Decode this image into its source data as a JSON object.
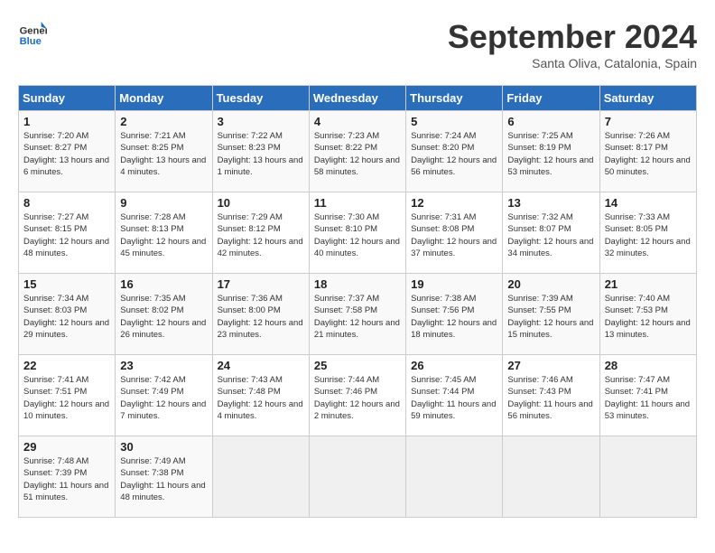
{
  "header": {
    "logo_general": "General",
    "logo_blue": "Blue",
    "month": "September 2024",
    "location": "Santa Oliva, Catalonia, Spain"
  },
  "weekdays": [
    "Sunday",
    "Monday",
    "Tuesday",
    "Wednesday",
    "Thursday",
    "Friday",
    "Saturday"
  ],
  "days": [
    {
      "date": "",
      "sunrise": "",
      "sunset": "",
      "daylight": ""
    },
    {
      "date": "1",
      "sunrise": "Sunrise: 7:20 AM",
      "sunset": "Sunset: 8:27 PM",
      "daylight": "Daylight: 13 hours and 6 minutes."
    },
    {
      "date": "2",
      "sunrise": "Sunrise: 7:21 AM",
      "sunset": "Sunset: 8:25 PM",
      "daylight": "Daylight: 13 hours and 4 minutes."
    },
    {
      "date": "3",
      "sunrise": "Sunrise: 7:22 AM",
      "sunset": "Sunset: 8:23 PM",
      "daylight": "Daylight: 13 hours and 1 minute."
    },
    {
      "date": "4",
      "sunrise": "Sunrise: 7:23 AM",
      "sunset": "Sunset: 8:22 PM",
      "daylight": "Daylight: 12 hours and 58 minutes."
    },
    {
      "date": "5",
      "sunrise": "Sunrise: 7:24 AM",
      "sunset": "Sunset: 8:20 PM",
      "daylight": "Daylight: 12 hours and 56 minutes."
    },
    {
      "date": "6",
      "sunrise": "Sunrise: 7:25 AM",
      "sunset": "Sunset: 8:19 PM",
      "daylight": "Daylight: 12 hours and 53 minutes."
    },
    {
      "date": "7",
      "sunrise": "Sunrise: 7:26 AM",
      "sunset": "Sunset: 8:17 PM",
      "daylight": "Daylight: 12 hours and 50 minutes."
    },
    {
      "date": "8",
      "sunrise": "Sunrise: 7:27 AM",
      "sunset": "Sunset: 8:15 PM",
      "daylight": "Daylight: 12 hours and 48 minutes."
    },
    {
      "date": "9",
      "sunrise": "Sunrise: 7:28 AM",
      "sunset": "Sunset: 8:13 PM",
      "daylight": "Daylight: 12 hours and 45 minutes."
    },
    {
      "date": "10",
      "sunrise": "Sunrise: 7:29 AM",
      "sunset": "Sunset: 8:12 PM",
      "daylight": "Daylight: 12 hours and 42 minutes."
    },
    {
      "date": "11",
      "sunrise": "Sunrise: 7:30 AM",
      "sunset": "Sunset: 8:10 PM",
      "daylight": "Daylight: 12 hours and 40 minutes."
    },
    {
      "date": "12",
      "sunrise": "Sunrise: 7:31 AM",
      "sunset": "Sunset: 8:08 PM",
      "daylight": "Daylight: 12 hours and 37 minutes."
    },
    {
      "date": "13",
      "sunrise": "Sunrise: 7:32 AM",
      "sunset": "Sunset: 8:07 PM",
      "daylight": "Daylight: 12 hours and 34 minutes."
    },
    {
      "date": "14",
      "sunrise": "Sunrise: 7:33 AM",
      "sunset": "Sunset: 8:05 PM",
      "daylight": "Daylight: 12 hours and 32 minutes."
    },
    {
      "date": "15",
      "sunrise": "Sunrise: 7:34 AM",
      "sunset": "Sunset: 8:03 PM",
      "daylight": "Daylight: 12 hours and 29 minutes."
    },
    {
      "date": "16",
      "sunrise": "Sunrise: 7:35 AM",
      "sunset": "Sunset: 8:02 PM",
      "daylight": "Daylight: 12 hours and 26 minutes."
    },
    {
      "date": "17",
      "sunrise": "Sunrise: 7:36 AM",
      "sunset": "Sunset: 8:00 PM",
      "daylight": "Daylight: 12 hours and 23 minutes."
    },
    {
      "date": "18",
      "sunrise": "Sunrise: 7:37 AM",
      "sunset": "Sunset: 7:58 PM",
      "daylight": "Daylight: 12 hours and 21 minutes."
    },
    {
      "date": "19",
      "sunrise": "Sunrise: 7:38 AM",
      "sunset": "Sunset: 7:56 PM",
      "daylight": "Daylight: 12 hours and 18 minutes."
    },
    {
      "date": "20",
      "sunrise": "Sunrise: 7:39 AM",
      "sunset": "Sunset: 7:55 PM",
      "daylight": "Daylight: 12 hours and 15 minutes."
    },
    {
      "date": "21",
      "sunrise": "Sunrise: 7:40 AM",
      "sunset": "Sunset: 7:53 PM",
      "daylight": "Daylight: 12 hours and 13 minutes."
    },
    {
      "date": "22",
      "sunrise": "Sunrise: 7:41 AM",
      "sunset": "Sunset: 7:51 PM",
      "daylight": "Daylight: 12 hours and 10 minutes."
    },
    {
      "date": "23",
      "sunrise": "Sunrise: 7:42 AM",
      "sunset": "Sunset: 7:49 PM",
      "daylight": "Daylight: 12 hours and 7 minutes."
    },
    {
      "date": "24",
      "sunrise": "Sunrise: 7:43 AM",
      "sunset": "Sunset: 7:48 PM",
      "daylight": "Daylight: 12 hours and 4 minutes."
    },
    {
      "date": "25",
      "sunrise": "Sunrise: 7:44 AM",
      "sunset": "Sunset: 7:46 PM",
      "daylight": "Daylight: 12 hours and 2 minutes."
    },
    {
      "date": "26",
      "sunrise": "Sunrise: 7:45 AM",
      "sunset": "Sunset: 7:44 PM",
      "daylight": "Daylight: 11 hours and 59 minutes."
    },
    {
      "date": "27",
      "sunrise": "Sunrise: 7:46 AM",
      "sunset": "Sunset: 7:43 PM",
      "daylight": "Daylight: 11 hours and 56 minutes."
    },
    {
      "date": "28",
      "sunrise": "Sunrise: 7:47 AM",
      "sunset": "Sunset: 7:41 PM",
      "daylight": "Daylight: 11 hours and 53 minutes."
    },
    {
      "date": "29",
      "sunrise": "Sunrise: 7:48 AM",
      "sunset": "Sunset: 7:39 PM",
      "daylight": "Daylight: 11 hours and 51 minutes."
    },
    {
      "date": "30",
      "sunrise": "Sunrise: 7:49 AM",
      "sunset": "Sunset: 7:38 PM",
      "daylight": "Daylight: 11 hours and 48 minutes."
    }
  ]
}
